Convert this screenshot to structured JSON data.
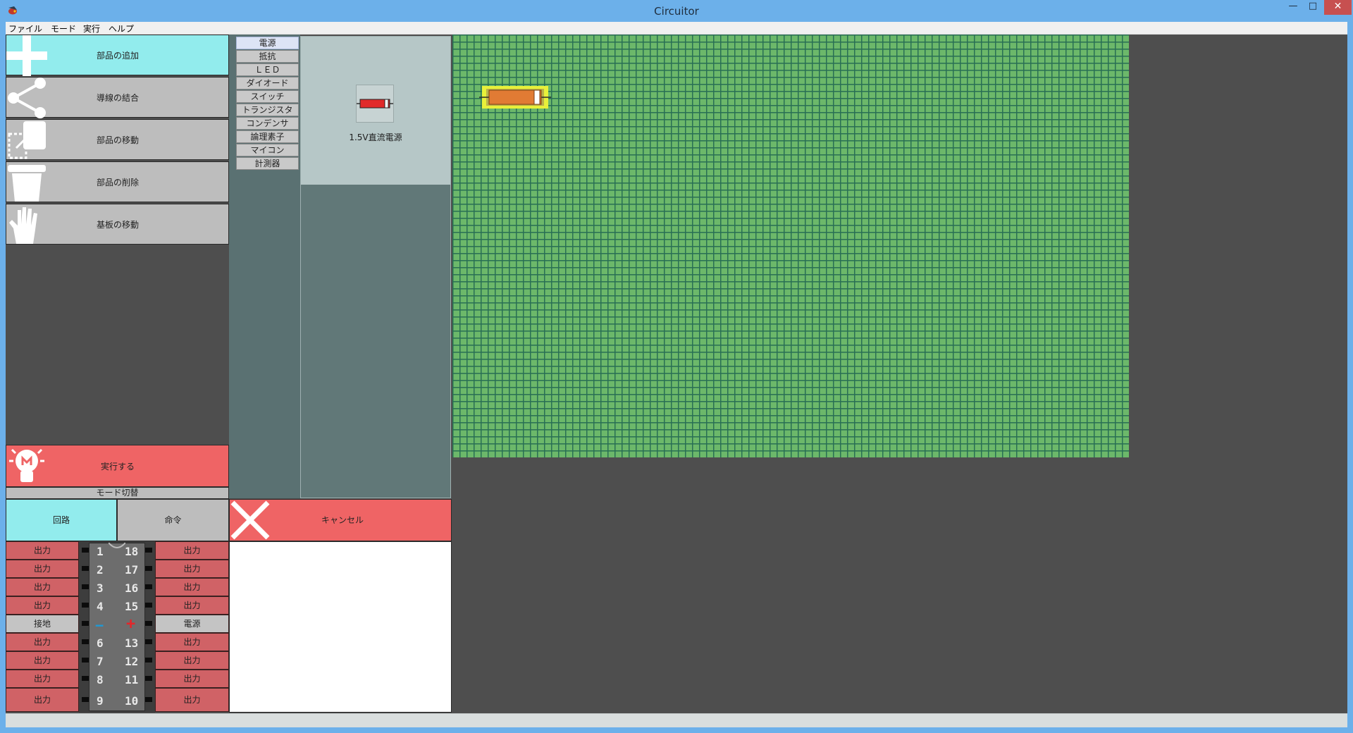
{
  "window": {
    "title": "Circuitor",
    "minimize": "—",
    "maximize": "□",
    "close": "✕"
  },
  "menu": {
    "items": [
      "ファイル",
      "モード",
      "実行",
      "ヘルプ"
    ]
  },
  "tools": [
    {
      "label": "部品の追加",
      "icon": "plus-icon",
      "active": true
    },
    {
      "label": "導線の結合",
      "icon": "share-connect-icon",
      "active": false
    },
    {
      "label": "部品の移動",
      "icon": "move-part-icon",
      "active": false
    },
    {
      "label": "部品の削除",
      "icon": "trash-icon",
      "active": false
    },
    {
      "label": "基板の移動",
      "icon": "hand-icon",
      "active": false
    }
  ],
  "run": {
    "label": "実行する",
    "icon": "lightbulb-icon"
  },
  "mode": {
    "title": "モード切替",
    "circuit": "回路",
    "command": "命令",
    "active": "circuit"
  },
  "categories": [
    "電源",
    "抵抗",
    "ＬＥＤ",
    "ダイオード",
    "スイッチ",
    "トランジスタ",
    "コンデンサ",
    "論理素子",
    "マイコン",
    "計測器"
  ],
  "active_category": "電源",
  "parts": [
    {
      "name": "1.5V直流電源",
      "icon": "battery-icon"
    }
  ],
  "cancel": {
    "label": "キャンセル",
    "icon": "x-icon"
  },
  "pins": {
    "left": [
      "出力",
      "出力",
      "出力",
      "出力",
      "接地",
      "出力",
      "出力",
      "出力",
      "出力"
    ],
    "right": [
      "出力",
      "出力",
      "出力",
      "出力",
      "電源",
      "出力",
      "出力",
      "出力",
      "出力"
    ],
    "left_numbers": [
      "1",
      "2",
      "3",
      "4",
      "−",
      "6",
      "7",
      "8",
      "9"
    ],
    "right_numbers": [
      "18",
      "17",
      "16",
      "15",
      "+",
      "13",
      "12",
      "11",
      "10"
    ]
  },
  "colors": {
    "active_tool": "#92eced",
    "inactive_tool": "#bdbdbd",
    "run_button": "#ef6465",
    "board": "#6cb86a",
    "board_grid": "#296f54",
    "pin_output": "#d06266",
    "pin_power": "#c4c4c4"
  }
}
